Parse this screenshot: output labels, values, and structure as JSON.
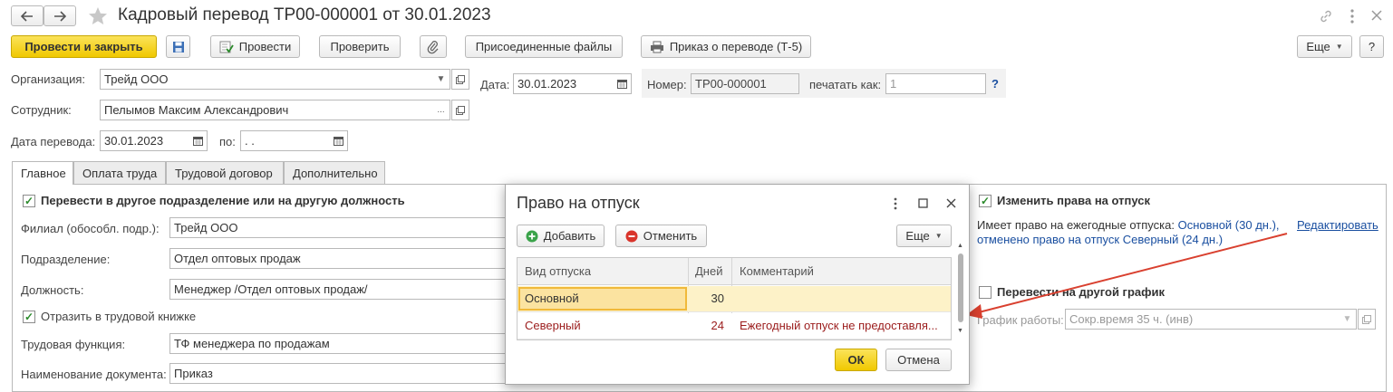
{
  "window": {
    "title": "Кадровый перевод ТР00-000001 от 30.01.2023",
    "back_icon": "arrow-left",
    "forward_icon": "arrow-right",
    "star_icon": "star",
    "link_icon": "chain-link",
    "more_icon": "vertical-dots",
    "close_icon": "x"
  },
  "toolbar": {
    "post_close": "Провести и закрыть",
    "post": "Провести",
    "check": "Проверить",
    "attached_files": "Присоединенные файлы",
    "order_print": "Приказ о переводе (Т-5)",
    "more": "Еще",
    "help": "?"
  },
  "header": {
    "org_label": "Организация:",
    "org_value": "Трейд ООО",
    "date_label": "Дата:",
    "date_value": "30.01.2023",
    "number_label": "Номер:",
    "number_value": "ТР00-000001",
    "print_as_label": "печатать как:",
    "print_as_value": "1",
    "help_mark": "?",
    "employee_label": "Сотрудник:",
    "employee_value": "Пелымов Максим Александрович",
    "transfer_date_label": "Дата перевода:",
    "transfer_date_value": "30.01.2023",
    "to_label": "по:",
    "to_value": " .  ."
  },
  "tabs": [
    "Главное",
    "Оплата труда",
    "Трудовой договор",
    "Дополнительно"
  ],
  "main": {
    "transfer_check_label": "Перевести в другое подразделение или на другую должность",
    "branch_label": "Филиал (обособл. подр.):",
    "branch_value": "Трейд ООО",
    "dept_label": "Подразделение:",
    "dept_value": "Отдел оптовых продаж",
    "position_label": "Должность:",
    "position_value": "Менеджер /Отдел оптовых продаж/",
    "workbook_label": "Отразить в трудовой книжке",
    "labor_func_label": "Трудовая функция:",
    "labor_func_value": "ТФ менеджера по продажам",
    "doc_name_label": "Наименование документа:",
    "doc_name_value": "Приказ"
  },
  "right_panel": {
    "change_vacation_label": "Изменить права на отпуск",
    "has_right_text": "Имеет право на ежегодные отпуска:",
    "has_right_value": "Основной (30 дн.),",
    "cancelled_text": "отменено право на отпуск Северный (24 дн.)",
    "edit_link": "Редактировать",
    "other_schedule_label": "Перевести на другой график",
    "schedule_label": "График работы:",
    "schedule_value": "Сокр.время 35 ч. (инв)"
  },
  "dialog": {
    "title": "Право на отпуск",
    "add": "Добавить",
    "cancel_item": "Отменить",
    "more": "Еще",
    "columns": [
      "Вид отпуска",
      "Дней",
      "Комментарий"
    ],
    "rows": [
      {
        "type": "Основной",
        "days": "30",
        "comment": ""
      },
      {
        "type": "Северный",
        "days": "24",
        "comment": "Ежегодный отпуск не предоставля..."
      }
    ],
    "ok": "ОК",
    "cancel": "Отмена"
  },
  "colors": {
    "accent_yellow": "#f0c800",
    "selected_row": "#fdf2c8",
    "cancelled_text": "#9b1c1c",
    "link": "#1a4fa0",
    "arrow": "#d9402f"
  }
}
